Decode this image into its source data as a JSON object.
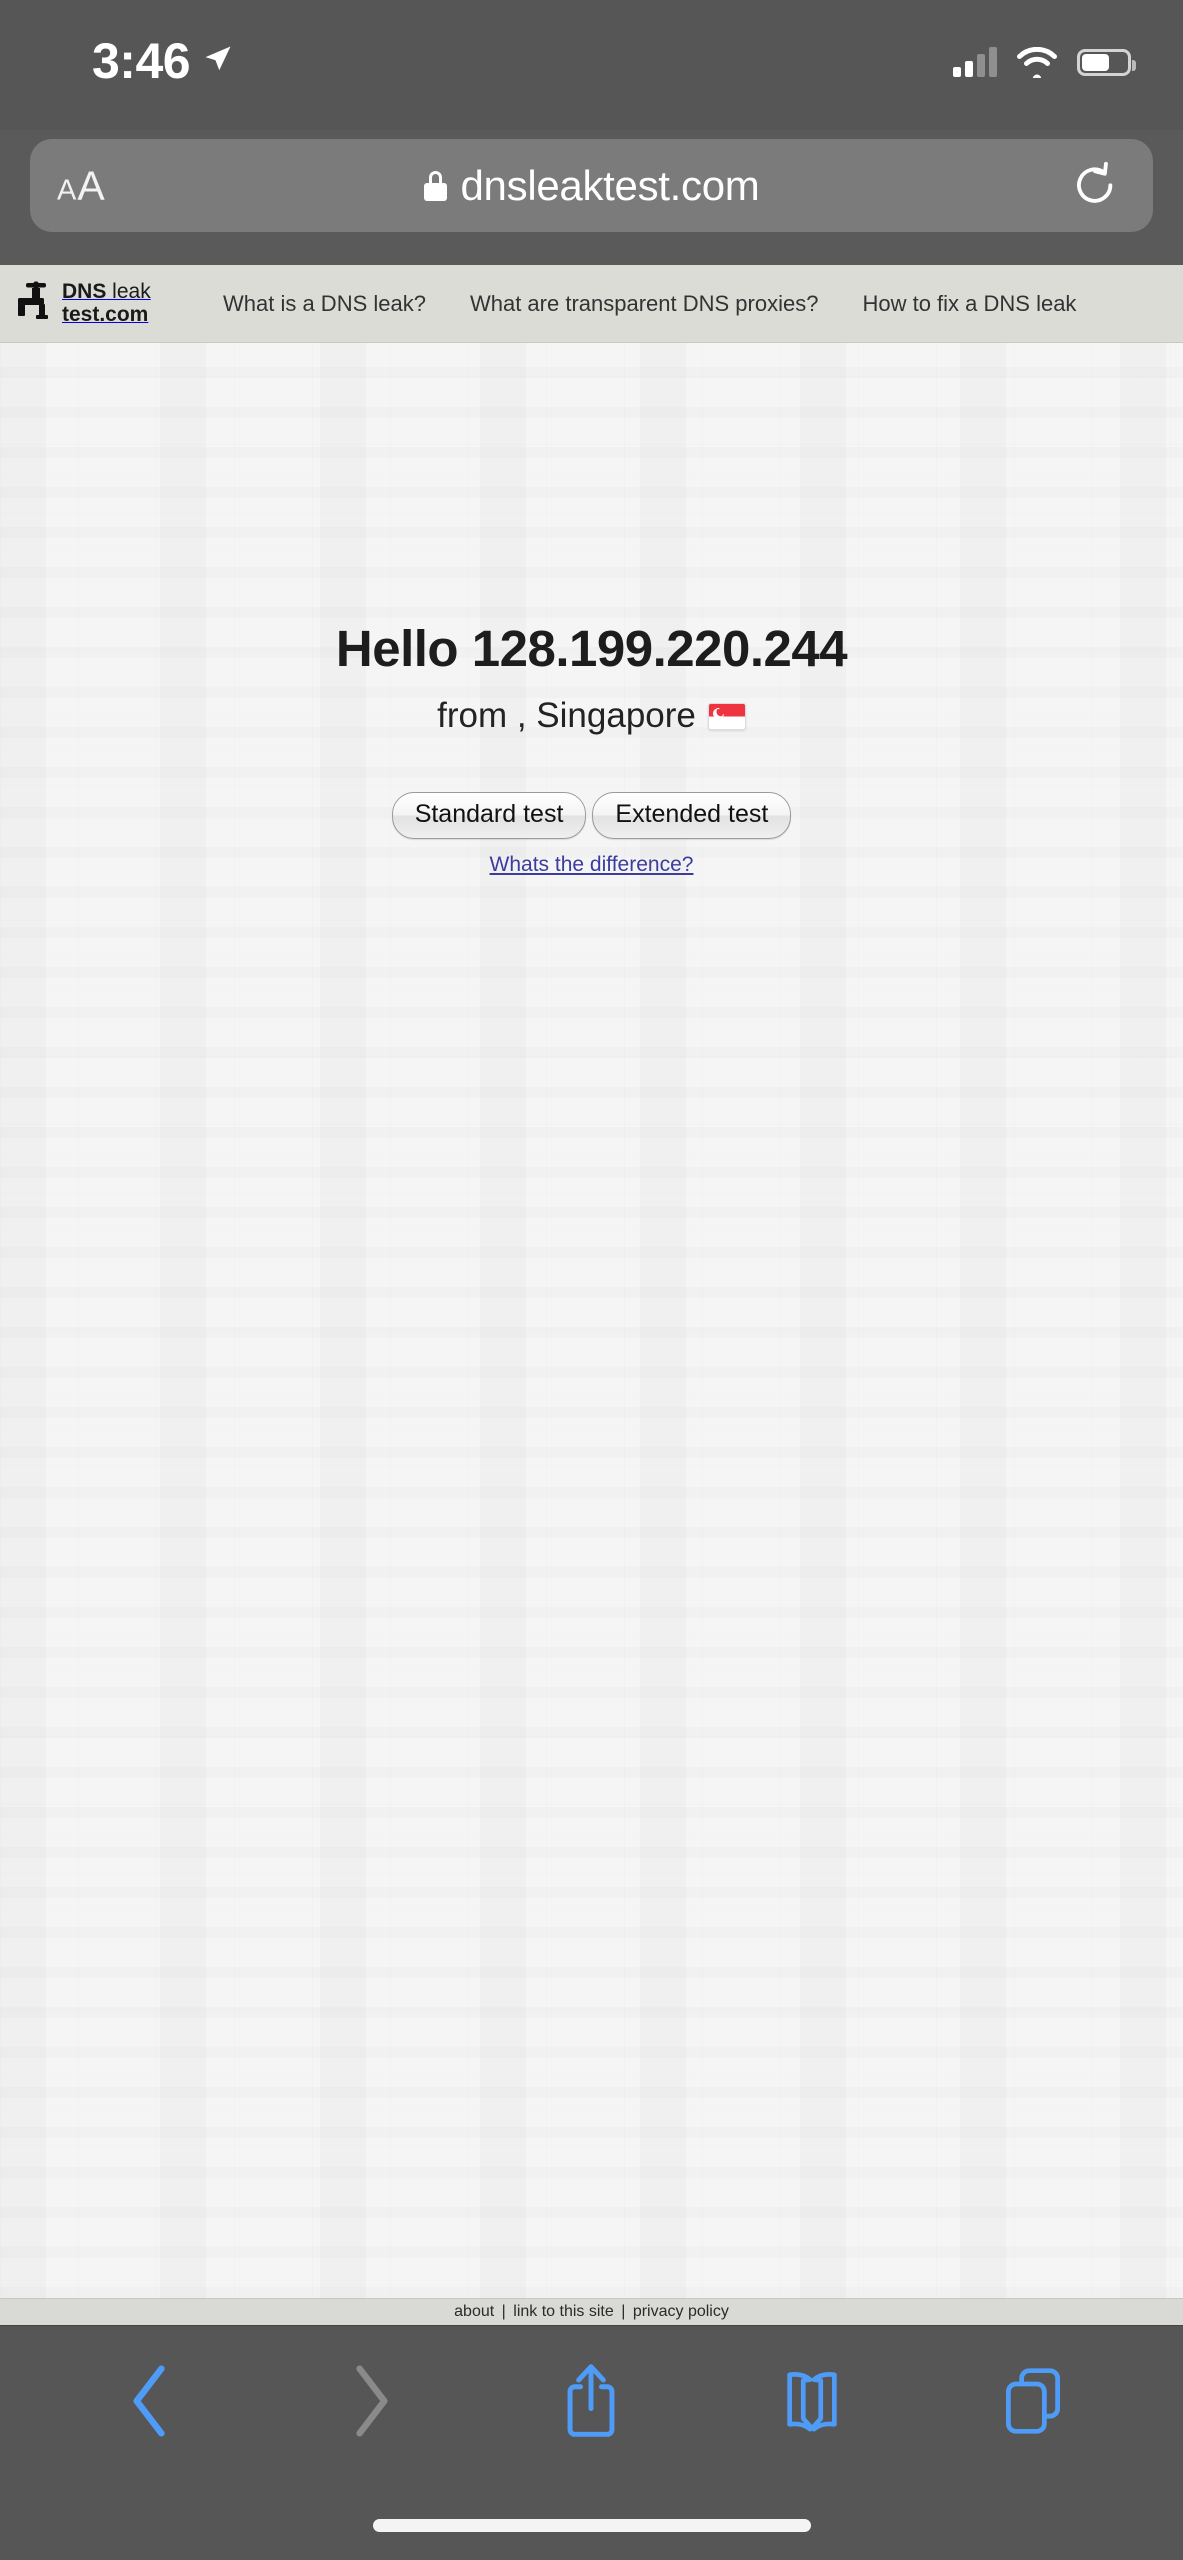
{
  "status_bar": {
    "time": "3:46",
    "location_icon": "location-arrow-icon",
    "cellular_icon": "cellular-signal-icon",
    "cellular_bars_filled": 2,
    "cellular_bars_total": 4,
    "wifi_icon": "wifi-icon",
    "battery_icon": "battery-icon",
    "battery_level_percent": 62
  },
  "browser": {
    "name": "Safari",
    "text_size_button": {
      "small": "A",
      "large": "A",
      "icon": "text-size-icon"
    },
    "secure_icon": "lock-icon",
    "url": "dnsleaktest.com",
    "reload_icon": "reload-icon",
    "toolbar": {
      "back": {
        "label": "Back",
        "icon": "chevron-left-icon",
        "enabled": true
      },
      "forward": {
        "label": "Forward",
        "icon": "chevron-right-icon",
        "enabled": false
      },
      "share": {
        "label": "Share",
        "icon": "share-icon"
      },
      "bookmarks": {
        "label": "Bookmarks",
        "icon": "book-icon"
      },
      "tabs": {
        "label": "Tabs",
        "icon": "tabs-icon"
      }
    }
  },
  "site": {
    "logo": {
      "icon": "faucet-tap-icon",
      "line1_bold": "DNS",
      "line1_rest": " leak",
      "line2": "test.com"
    },
    "nav": [
      {
        "label": "What is a DNS leak?"
      },
      {
        "label": "What are transparent DNS proxies?"
      },
      {
        "label": "How to fix a DNS leak"
      }
    ],
    "main": {
      "greeting_prefix": "Hello",
      "ip_address": "128.199.220.244",
      "heading": "Hello 128.199.220.244",
      "from_label": "from , Singapore",
      "country": "Singapore",
      "flag_icon": "singapore-flag-icon",
      "buttons": [
        {
          "label": "Standard test"
        },
        {
          "label": "Extended test"
        }
      ],
      "difference_link": "Whats the difference?"
    },
    "footer": {
      "links": [
        {
          "label": "about"
        },
        {
          "label": "link to this site"
        },
        {
          "label": "privacy policy"
        }
      ],
      "separator": "|"
    }
  },
  "colors": {
    "chrome_bg": "#565656",
    "url_field_bg": "#7b7b7b",
    "nav_bg": "#dcdcd7",
    "page_bg": "#f5f5f5",
    "footer_bg": "#d9d9d5",
    "link_purple": "#3c3c9e",
    "toolbar_accent": "#4f9cf8",
    "toolbar_disabled": "#8a8a8a"
  }
}
